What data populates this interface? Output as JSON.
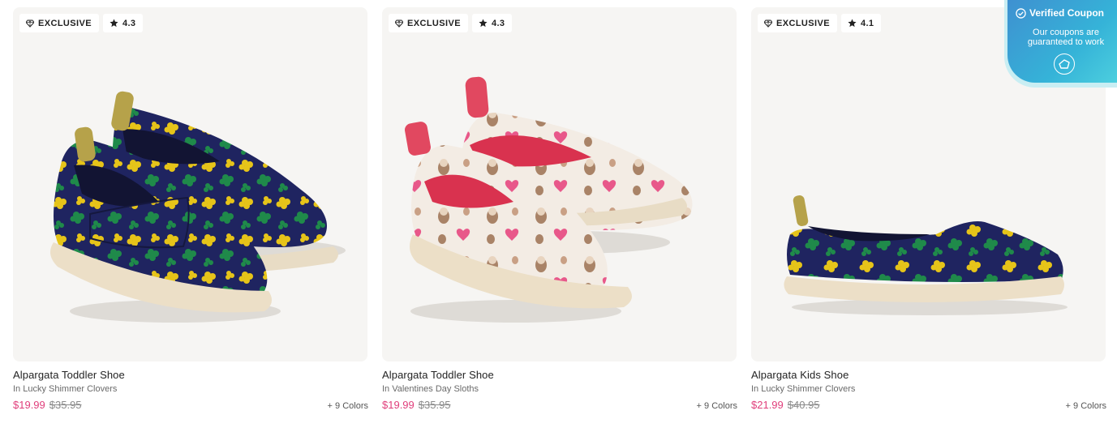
{
  "products": [
    {
      "badge_exclusive": "EXCLUSIVE",
      "rating": "4.3",
      "name": "Alpargata Toddler Shoe",
      "variant": "In Lucky Shimmer Clovers",
      "sale_price": "$19.99",
      "original_price": "$35.95",
      "colors": "+ 9 Colors"
    },
    {
      "badge_exclusive": "EXCLUSIVE",
      "rating": "4.3",
      "name": "Alpargata Toddler Shoe",
      "variant": "In Valentines Day Sloths",
      "sale_price": "$19.99",
      "original_price": "$35.95",
      "colors": "+ 9 Colors"
    },
    {
      "badge_exclusive": "EXCLUSIVE",
      "rating": "4.1",
      "name": "Alpargata Kids Shoe",
      "variant": "In Lucky Shimmer Clovers",
      "sale_price": "$21.99",
      "original_price": "$40.95",
      "colors": "+ 9 Colors"
    }
  ],
  "coupon": {
    "title": "Verified Coupon",
    "text": "Our coupons are guaranteed to work"
  },
  "icons": {
    "exclusive": "diamond-icon",
    "rating": "star-icon",
    "verified": "check-circle-icon",
    "logo": "coupon-logo-icon"
  },
  "colors": {
    "sale_price": "#e03e7b",
    "card_background": "#f6f5f3",
    "coupon_gradient_start": "#3f8fd0",
    "coupon_gradient_end": "#4fd2df",
    "clover_shoe_navy": "#1f2460",
    "clover_leaf_green": "#1f8a4a",
    "clover_leaf_yellow": "#e6c419",
    "sloth_shoe_base": "#f3ece4",
    "sloth_shoe_lining": "#d9324f"
  }
}
